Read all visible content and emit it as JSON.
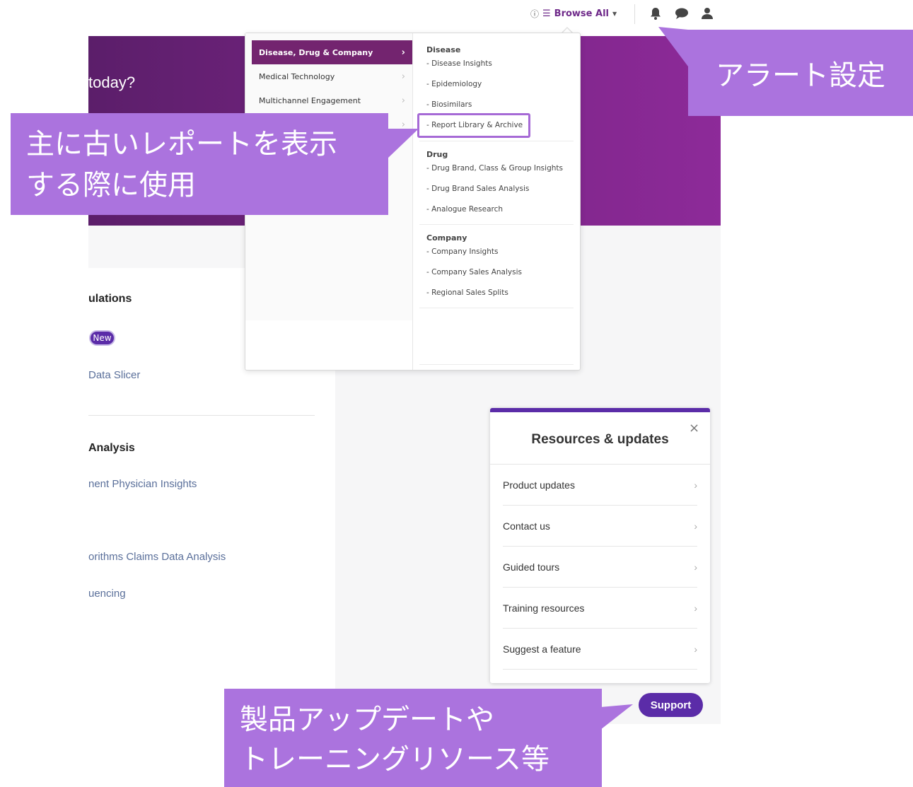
{
  "topbar": {
    "info_icon": "info-circle-icon",
    "browse_label": "Browse All",
    "icons": [
      "bell-icon",
      "chat-bubble-icon",
      "user-icon"
    ]
  },
  "background": {
    "hero_text": "today?",
    "sections": [
      {
        "title": "ulations",
        "links": [
          "Data Slicer"
        ],
        "badge": "New"
      },
      {
        "title": "Analysis",
        "links": [
          "nent Physician Insights",
          "orithms Claims Data Analysis",
          "uencing"
        ]
      }
    ]
  },
  "menu": {
    "categories": [
      {
        "label": "Disease, Drug & Company",
        "active": true
      },
      {
        "label": "Medical Technology",
        "active": false
      },
      {
        "label": "Multichannel Engagement",
        "active": false
      },
      {
        "label": "",
        "active": false
      }
    ],
    "groups": [
      {
        "title": "Disease",
        "items": [
          "- Disease Insights",
          "- Epidemiology",
          "- Biosimilars",
          "- Report Library & Archive"
        ]
      },
      {
        "title": "Drug",
        "items": [
          "- Drug Brand, Class & Group Insights",
          "- Drug Brand Sales Analysis",
          "- Analogue Research"
        ]
      },
      {
        "title": "Company",
        "items": [
          "- Company Insights",
          "- Company Sales Analysis",
          "- Regional Sales Splits"
        ]
      }
    ]
  },
  "resources": {
    "title": "Resources & updates",
    "close": "×",
    "items": [
      "Product updates",
      "Contact us",
      "Guided tours",
      "Training resources",
      "Suggest a feature"
    ]
  },
  "support_button": "Support",
  "callouts": {
    "alert": "アラート設定",
    "report": "主に古いレポートを表示\nする際に使用",
    "support": "製品アップデートや\nトレーニングリソース等"
  },
  "colors": {
    "brand_purple": "#73246f",
    "accent_violet": "#5b2ca8",
    "callout": "#ab73de",
    "highlight": "#a66ad6"
  }
}
